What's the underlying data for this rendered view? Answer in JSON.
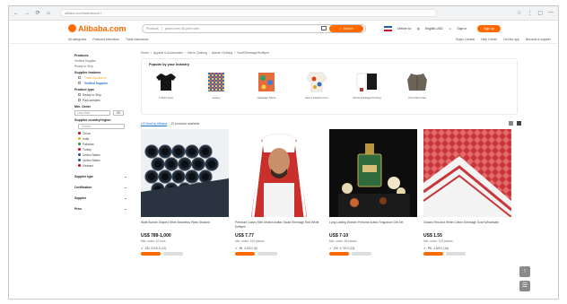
{
  "browser": {
    "url": "alibaba.com/trade/search?...",
    "nav": [
      "←",
      "→",
      "⟳",
      "⌂"
    ],
    "right_icons": [
      "☆",
      "⋮",
      "▢",
      "—"
    ]
  },
  "header": {
    "logo_text": "Alibaba.com",
    "search_category": "Products",
    "search_placeholder": "jacket men 3D-print shirt",
    "search_button": "Search",
    "deliver_to": "Deliver to:",
    "language": "English-USD",
    "signin": "Sign in",
    "signup": "Sign up"
  },
  "subnav": {
    "left": [
      "All categories",
      "Featured selections",
      "Trade Assurance"
    ],
    "right": [
      "Buyer Central",
      "Help Center",
      "Get the app",
      "Become a supplier"
    ]
  },
  "sidebar": {
    "title": "Products",
    "lines": [
      "Verified Supplier",
      "Ready to Ship"
    ],
    "supplier_title": "Supplier features",
    "supplier_opts": [
      {
        "label": "Trade Assurance",
        "color": "#f5a623"
      },
      {
        "label": "Verified Supplier",
        "color": "#1f6fd1"
      }
    ],
    "product_title": "Product type",
    "product_opts": [
      "Ready to Ship",
      "Paid samples"
    ],
    "minorder_title": "Min. Order",
    "minorder_placeholder": "Less than",
    "minorder_ok": "OK",
    "country_title": "Supplier country/region",
    "country_search": "Search",
    "countries": [
      {
        "label": "China",
        "color": "#d0021b"
      },
      {
        "label": "India",
        "color": "#f5a623"
      },
      {
        "label": "Pakistan",
        "color": "#2e8b57"
      },
      {
        "label": "Turkey",
        "color": "#d0021b"
      },
      {
        "label": "United States",
        "color": "#1f4fa8"
      },
      {
        "label": "United States",
        "color": "#1f4fa8"
      },
      {
        "label": "Vietnam",
        "color": "#d0021b"
      }
    ],
    "collapsed": [
      "Supplier type",
      "Certification",
      "Supplier",
      "Price"
    ]
  },
  "main": {
    "breadcrumbs": [
      "Home",
      "Apparel & Accessories",
      "Men's Clothing",
      "Islamic Clothing",
      "Scarf/Shemagh/Keffiyeh"
    ],
    "popular_title": "Popular by your industry",
    "popular": [
      {
        "label": "T-Shirt Tops",
        "icon": "tshirt"
      },
      {
        "label": "Jersey",
        "icon": "jersey"
      },
      {
        "label": "Hawaiian Shirts",
        "icon": "hawaiian"
      },
      {
        "label": "Men's Fashion Knit",
        "icon": "knit"
      },
      {
        "label": "Shirts Package Printing",
        "icon": "set"
      },
      {
        "label": "Print Shirt Flat",
        "icon": "jacket"
      }
    ],
    "results_link": "US Deal by Alibaba",
    "results_text": "· 10 products available",
    "cards": [
      {
        "title": "Wide Bundle Shaped Steel Seamless Pipes Stocked",
        "price": "US$ 789-1,000",
        "moq": "Min. order: 10 tons",
        "supplier": "CN",
        "rate": "5.0/5.0 (12)",
        "image": "pipes"
      },
      {
        "title": "Premium Luxury Men Muslim Arabic Saudi Shemagh Red White Keffiyeh",
        "price": "US$ 7.77",
        "moq": "Min. order: 100 pieces",
        "supplier": "IN",
        "rate": "4.9/5.0 (8)",
        "image": "man"
      },
      {
        "title": "Long Lasting Women Perfume Arabic Fragrance Gift Set",
        "price": "US$ 7-10",
        "moq": "Min. order: 48 pieces",
        "supplier": "CN",
        "rate": "4.7/5.0 (23)",
        "image": "perfume"
      },
      {
        "title": "Classic Red and White Cotton Shemagh Scarf Wholesale",
        "price": "US$ 1.55",
        "moq": "Min. order: 120 pieces",
        "supplier": "PK",
        "rate": "4.8/5.0 (16)",
        "image": "scarf"
      }
    ]
  },
  "floating": [
    "↑",
    "☰"
  ]
}
